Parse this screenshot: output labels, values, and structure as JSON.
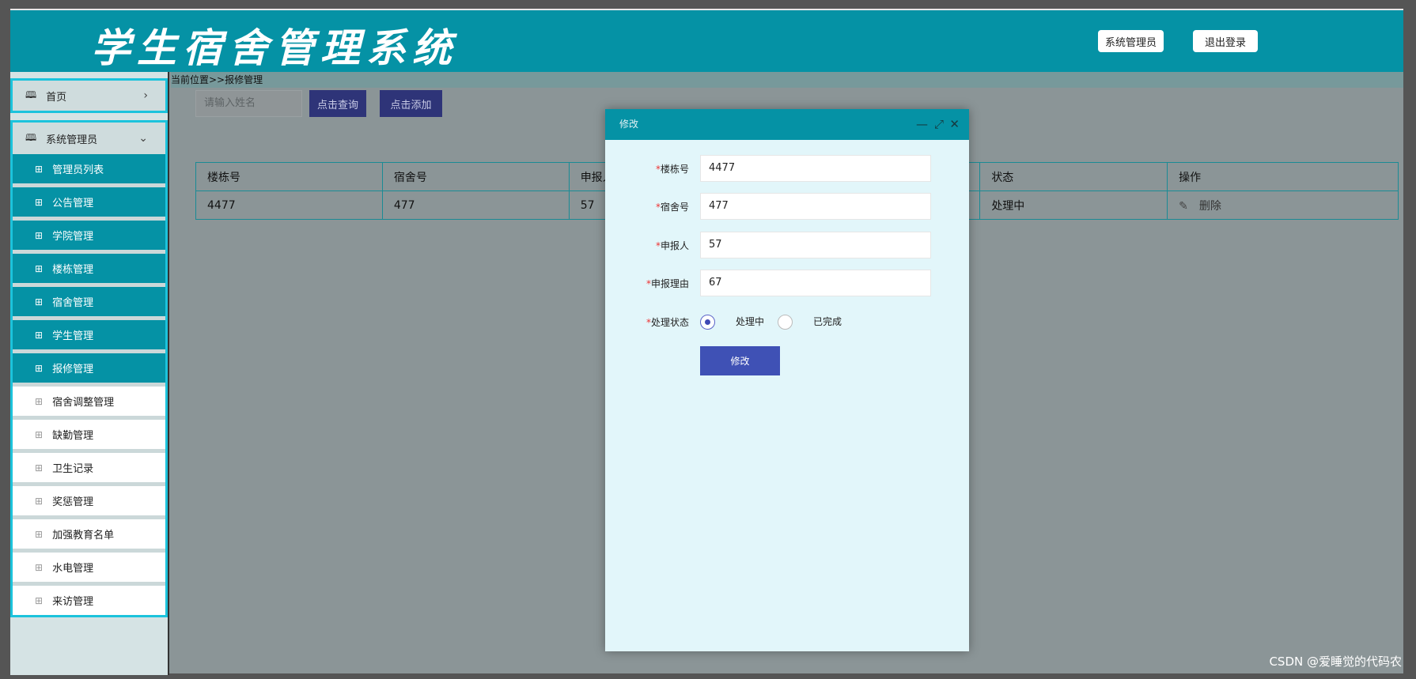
{
  "header": {
    "title": "学生宿舍管理系统",
    "user_label": "系统管理员",
    "logout_label": "退出登录"
  },
  "sidebar": {
    "home": {
      "label": "首页",
      "icon": "book-icon"
    },
    "group": {
      "label": "系统管理员",
      "icon": "book-icon"
    },
    "items": [
      {
        "label": "管理员列表",
        "active": true
      },
      {
        "label": "公告管理",
        "active": true
      },
      {
        "label": "学院管理",
        "active": true
      },
      {
        "label": "楼栋管理",
        "active": true
      },
      {
        "label": "宿舍管理",
        "active": true
      },
      {
        "label": "学生管理",
        "active": true
      },
      {
        "label": "报修管理",
        "active": true
      },
      {
        "label": "宿舍调整管理",
        "active": false
      },
      {
        "label": "缺勤管理",
        "active": false
      },
      {
        "label": "卫生记录",
        "active": false
      },
      {
        "label": "奖惩管理",
        "active": false
      },
      {
        "label": "加强教育名单",
        "active": false
      },
      {
        "label": "水电管理",
        "active": false
      },
      {
        "label": "来访管理",
        "active": false
      }
    ]
  },
  "content": {
    "breadcrumb": "当前位置>>报修管理",
    "search_placeholder": "请输入姓名",
    "query_label": "点击查询",
    "add_label": "点击添加",
    "table": {
      "headers": [
        "楼栋号",
        "宿舍号",
        "申报人",
        "",
        "状态",
        "操作"
      ],
      "rows": [
        [
          "4477",
          "477",
          "57",
          "",
          "处理中",
          ""
        ]
      ],
      "delete_label": "删除"
    }
  },
  "modal": {
    "title": "修改",
    "fields": [
      {
        "label": "楼栋号",
        "value": "4477"
      },
      {
        "label": "宿舍号",
        "value": "477"
      },
      {
        "label": "申报人",
        "value": "57"
      },
      {
        "label": "申报理由",
        "value": "67"
      }
    ],
    "status": {
      "label": "处理状态",
      "options": [
        "处理中",
        "已完成"
      ],
      "selected": "处理中"
    },
    "submit_label": "修改"
  },
  "watermark": "CSDN @爱睡觉的代码农",
  "colors": {
    "header": "#0592a5",
    "primary_button": "#3f51b5",
    "sidebar_border": "#1cc3dc"
  }
}
